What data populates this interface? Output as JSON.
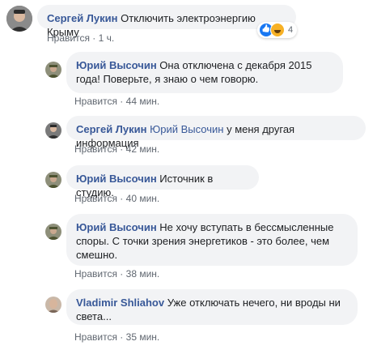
{
  "colors": {
    "author": "#385898",
    "meta": "#606770",
    "bubble": "#f2f3f5"
  },
  "comments": [
    {
      "author": "Сергей Лукин",
      "mention": "",
      "text": "Отключить электроэнергию Крыму",
      "like": "Нравится",
      "time": "1 ч.",
      "reaction_icons": [
        "like-icon",
        "haha-icon"
      ],
      "reaction_count": "4",
      "sep": "·"
    },
    {
      "author": "Юрий Высочин",
      "mention": "",
      "text": "Она отключена с декабря 2015 года! Поверьте, я знаю о чем говорю.",
      "like": "Нравится",
      "time": "44 мин.",
      "sep": "·"
    },
    {
      "author": "Сергей Лукин",
      "mention": "Юрий Высочин",
      "text": "у меня другая информация",
      "like": "Нравится",
      "time": "42 мин.",
      "sep": "·"
    },
    {
      "author": "Юрий Высочин",
      "mention": "",
      "text": "Источник в студию.",
      "like": "Нравится",
      "time": "40 мин.",
      "sep": "·"
    },
    {
      "author": "Юрий Высочин",
      "mention": "",
      "text": "Не хочу вступать в бессмысленные споры. С точки зрения энергетиков - это более, чем смешно.",
      "like": "Нравится",
      "time": "38 мин.",
      "sep": "·"
    },
    {
      "author": "Vladimir Shliahov",
      "mention": "",
      "text": "Уже отключать нечего, ни вроды ни света...",
      "like": "Нравится",
      "time": "35 мин.",
      "sep": "·"
    }
  ]
}
